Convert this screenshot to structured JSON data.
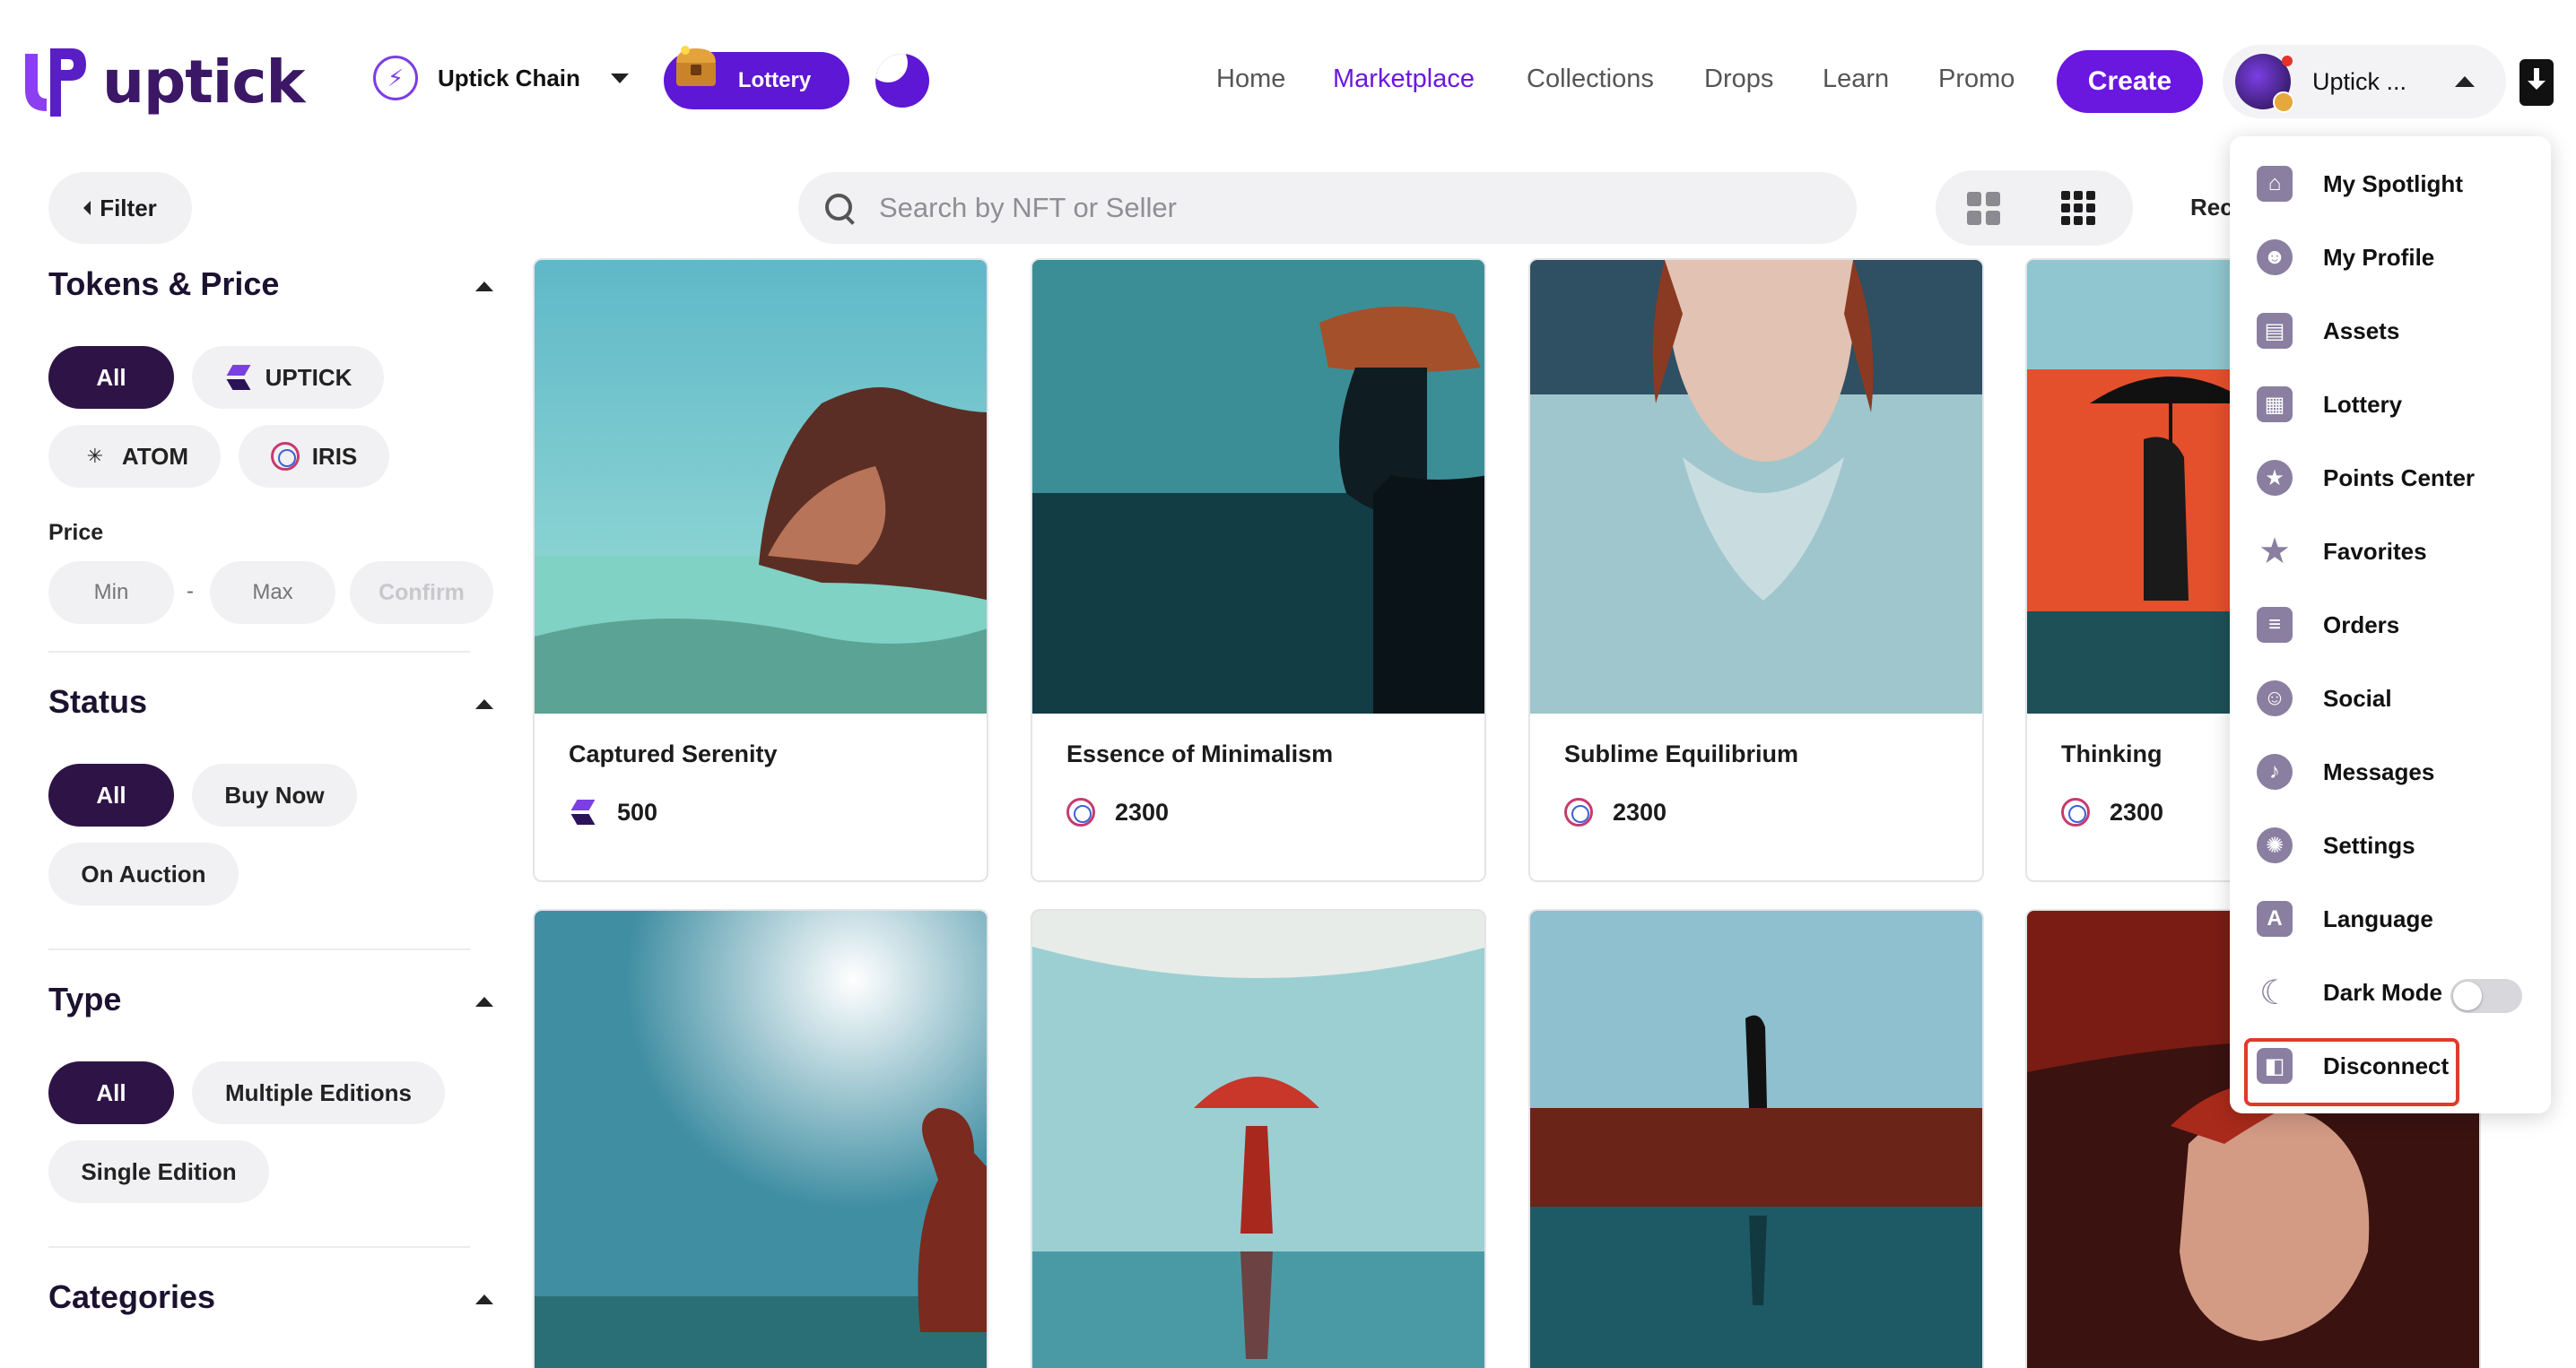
{
  "header": {
    "logo_text": "uptick",
    "chain_label": "Uptick Chain",
    "lottery_label": "Lottery",
    "nav": [
      {
        "label": "Home",
        "active": false
      },
      {
        "label": "Marketplace",
        "active": true
      },
      {
        "label": "Collections",
        "active": false
      },
      {
        "label": "Drops",
        "active": false
      },
      {
        "label": "Learn",
        "active": false
      },
      {
        "label": "Promo",
        "active": false
      }
    ],
    "create_label": "Create",
    "account_name": "Uptick ..."
  },
  "sidebar": {
    "filter_label": "Filter",
    "tokens_title": "Tokens & Price",
    "tokens": [
      "All",
      "UPTICK",
      "ATOM",
      "IRIS"
    ],
    "price_label": "Price",
    "min_placeholder": "Min",
    "max_placeholder": "Max",
    "dash": "-",
    "confirm_label": "Confirm",
    "status_title": "Status",
    "status": [
      "All",
      "Buy Now",
      "On Auction"
    ],
    "type_title": "Type",
    "types": [
      "All",
      "Multiple Editions",
      "Single Edition"
    ],
    "categories_title": "Categories"
  },
  "search": {
    "placeholder": "Search by NFT or Seller"
  },
  "sort_label": "Rec",
  "cards": [
    {
      "title": "Captured Serenity",
      "token": "UPTICK",
      "price": "500"
    },
    {
      "title": "Essence of Minimalism",
      "token": "IRIS",
      "price": "2300"
    },
    {
      "title": "Sublime Equilibrium",
      "token": "IRIS",
      "price": "2300"
    },
    {
      "title": "Thinking",
      "token": "IRIS",
      "price": "2300"
    }
  ],
  "dropdown": {
    "items": [
      {
        "label": "My Spotlight",
        "icon": "spotlight-icon"
      },
      {
        "label": "My Profile",
        "icon": "profile-icon"
      },
      {
        "label": "Assets",
        "icon": "assets-icon"
      },
      {
        "label": "Lottery",
        "icon": "lottery-icon"
      },
      {
        "label": "Points Center",
        "icon": "points-icon"
      },
      {
        "label": "Favorites",
        "icon": "star-icon"
      },
      {
        "label": "Orders",
        "icon": "orders-icon"
      },
      {
        "label": "Social",
        "icon": "social-icon"
      },
      {
        "label": "Messages",
        "icon": "bell-icon"
      },
      {
        "label": "Settings",
        "icon": "gear-icon"
      },
      {
        "label": "Language",
        "icon": "language-icon"
      },
      {
        "label": "Dark Mode",
        "icon": "moon-icon"
      },
      {
        "label": "Disconnect",
        "icon": "wallet-icon"
      }
    ],
    "dark_mode_enabled": false,
    "language_icon_letter": "A"
  },
  "colors": {
    "brand_purple": "#6a17e0",
    "dark_pill": "#2e1446",
    "highlight_red": "#e03a2a"
  }
}
